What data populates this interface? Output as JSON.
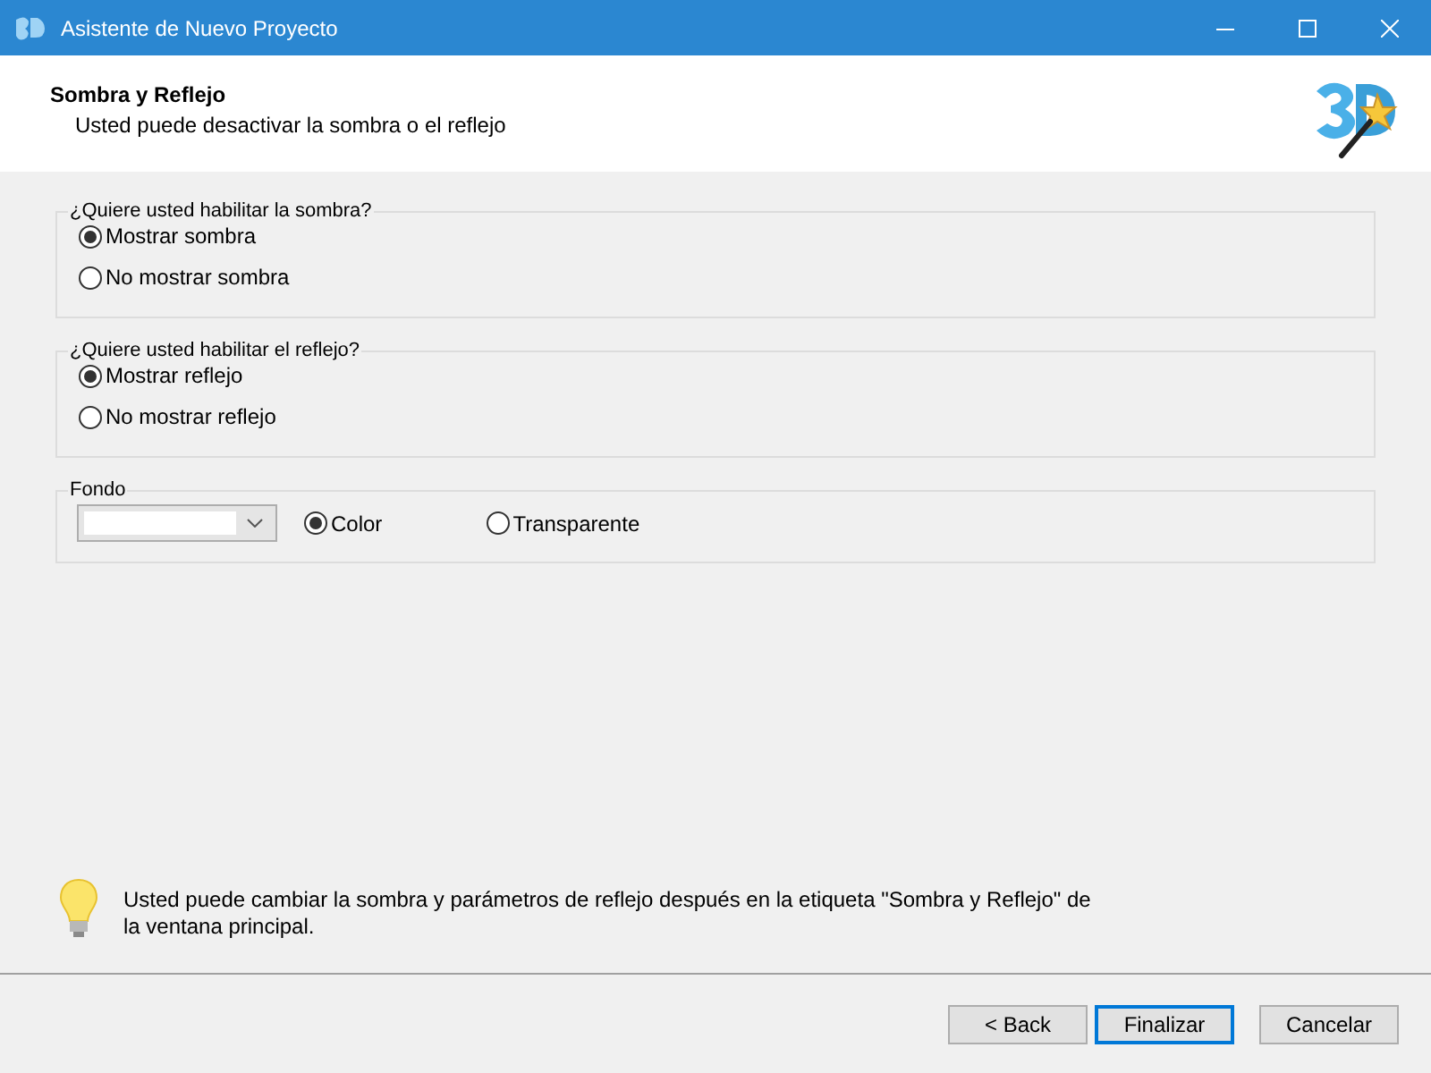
{
  "window": {
    "title": "Asistente de Nuevo Proyecto"
  },
  "header": {
    "title": "Sombra y Reflejo",
    "subtitle": "Usted puede desactivar la sombra o el reflejo"
  },
  "groups": [
    {
      "kind": "radio",
      "title": "¿Quiere usted habilitar la sombra?",
      "options": [
        {
          "label": "Mostrar sombra",
          "selected": true
        },
        {
          "label": "No mostrar sombra",
          "selected": false
        }
      ]
    },
    {
      "kind": "radio",
      "title": "¿Quiere usted habilitar el reflejo?",
      "options": [
        {
          "label": "Mostrar reflejo",
          "selected": true
        },
        {
          "label": "No mostrar reflejo",
          "selected": false
        }
      ]
    },
    {
      "kind": "background",
      "title": "Fondo",
      "options": [
        {
          "label": "Color",
          "selected": true
        },
        {
          "label": "Transparente",
          "selected": false
        }
      ]
    }
  ],
  "hint": "Usted puede cambiar la sombra y parámetros de reflejo después en la etiqueta \"Sombra y Reflejo\" de la ventana principal.",
  "buttons": [
    {
      "label": "< Back",
      "default": false
    },
    {
      "label": "Finalizar",
      "default": true
    },
    {
      "label": "Cancelar",
      "default": false
    }
  ]
}
